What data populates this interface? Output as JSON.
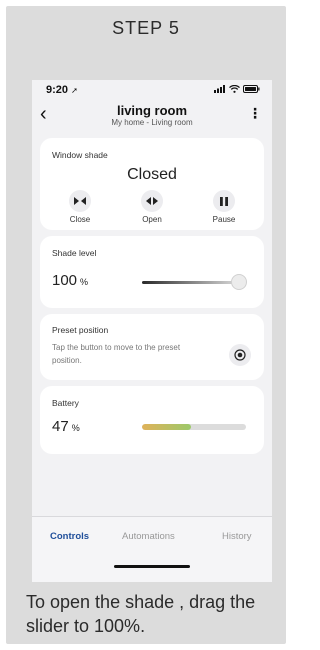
{
  "step_title": "STEP 5",
  "status_bar": {
    "time": "9:20",
    "location_icon": "location-arrow-icon",
    "signal_icon": "signal-icon",
    "wifi_icon": "wifi-icon",
    "battery_icon": "battery-icon"
  },
  "header": {
    "back_icon": "chevron-left-icon",
    "title": "living room",
    "subtitle": "My home - Living room",
    "menu_icon": "more-vertical-icon"
  },
  "shade_card": {
    "label": "Window shade",
    "state": "Closed",
    "controls": [
      {
        "label": "Close",
        "icon": "close-arrows-icon"
      },
      {
        "label": "Open",
        "icon": "open-arrows-icon"
      },
      {
        "label": "Pause",
        "icon": "pause-icon"
      }
    ]
  },
  "level_card": {
    "label": "Shade level",
    "value": "100",
    "unit": "%",
    "slider_value": 100
  },
  "preset_card": {
    "label": "Preset position",
    "description": "Tap the button to move to the preset position.",
    "button_icon": "target-icon"
  },
  "battery_card": {
    "label": "Battery",
    "value": "47",
    "unit": "%",
    "level": 47
  },
  "tabs": [
    {
      "label": "Controls",
      "active": true
    },
    {
      "label": "Automations",
      "active": false
    },
    {
      "label": "History",
      "active": false
    }
  ],
  "caption": "To open the shade , drag the slider to 100%.",
  "colors": {
    "frame_bg": "#dcdcdc",
    "active_tab": "#1f4e9a",
    "card_bg": "#ffffff"
  }
}
